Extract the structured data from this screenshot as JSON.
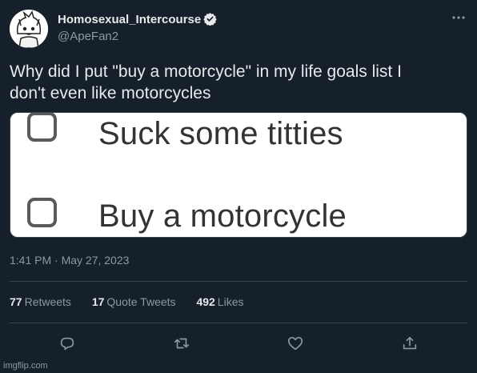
{
  "author": {
    "display_name": "Homosexual_Intercourse",
    "handle": "@ApeFan2",
    "verified": true
  },
  "tweet": {
    "text_line1": "Why did I put \"buy a motorcycle\" in my life goals list I",
    "text_line2": "don't even like motorcycles",
    "timestamp": "1:41 PM · May 27, 2023"
  },
  "media": {
    "items": [
      {
        "label": "Suck some titties",
        "checked": false
      },
      {
        "label": "Buy a motorcycle",
        "checked": false
      }
    ]
  },
  "stats": {
    "retweets_count": "77",
    "retweets_label": "Retweets",
    "quotes_count": "17",
    "quotes_label": "Quote Tweets",
    "likes_count": "492",
    "likes_label": "Likes"
  },
  "icons": {
    "reply": "reply-icon",
    "retweet": "retweet-icon",
    "like": "like-icon",
    "share": "share-icon",
    "more": "more-icon",
    "verified": "verified-badge-icon"
  },
  "colors": {
    "background": "#15202b",
    "primary_text": "#e7e9ea",
    "secondary_text": "#8b98a5",
    "divider": "#38444d"
  },
  "watermark": "imgflip.com"
}
